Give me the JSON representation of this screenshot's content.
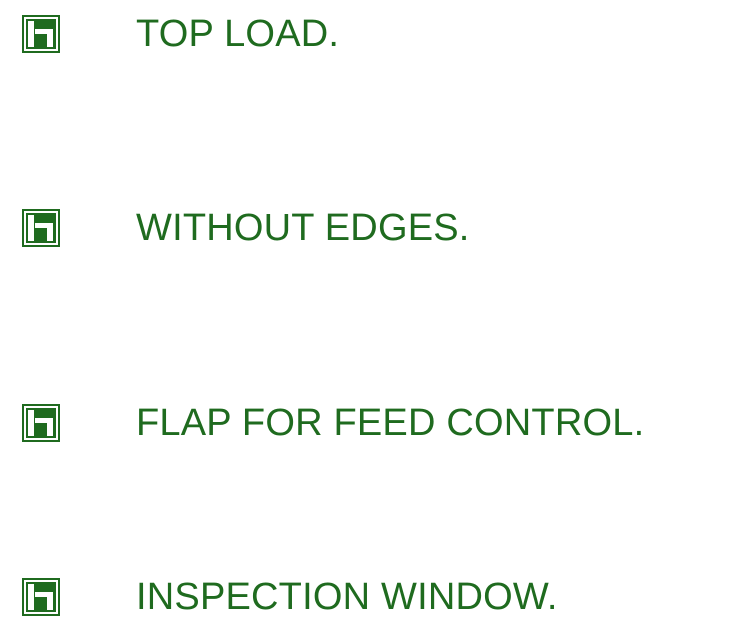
{
  "colors": {
    "brand_green": "#1f6b1f",
    "white": "#ffffff"
  },
  "icon_name": "brand-logo-icon",
  "features": [
    {
      "label": "TOP LOAD."
    },
    {
      "label": "WITHOUT EDGES."
    },
    {
      "label": "FLAP FOR FEED CONTROL."
    },
    {
      "label": "INSPECTION WINDOW."
    }
  ]
}
